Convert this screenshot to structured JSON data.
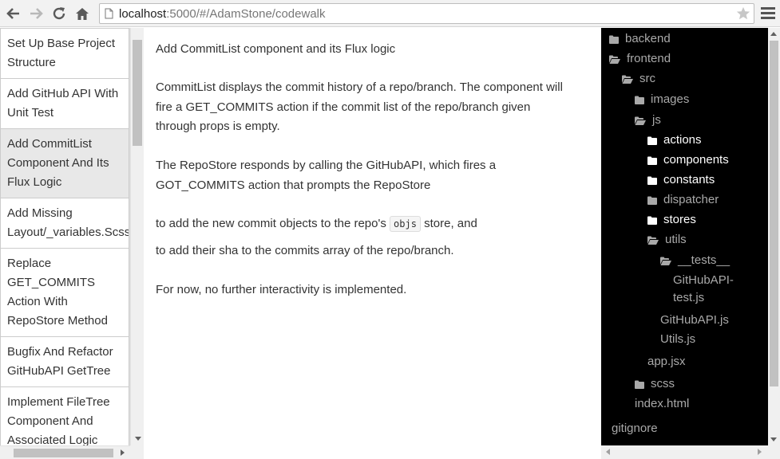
{
  "browser": {
    "url_host": "localhost",
    "url_path": ":5000/#/AdamStone/codewalk"
  },
  "sidebar": {
    "steps": [
      {
        "lines": [
          "Set Up Base Project",
          "Structure"
        ]
      },
      {
        "lines": [
          "Add GitHub API With",
          "Unit Test"
        ]
      },
      {
        "lines": [
          "Add CommitList",
          "Component And Its",
          "Flux Logic"
        ],
        "active": true
      },
      {
        "lines": [
          "Add Missing",
          "Layout/_variables.Scss"
        ]
      },
      {
        "lines": [
          "Replace",
          "GET_COMMITS",
          "Action With",
          "RepoStore Method"
        ]
      },
      {
        "lines": [
          "Bugfix And Refactor",
          "GitHubAPI GetTree"
        ]
      },
      {
        "lines": [
          "Implement FileTree",
          "Component And",
          "Associated Logic"
        ]
      }
    ]
  },
  "main": {
    "title": "Add CommitList component and its Flux logic",
    "para1": [
      "CommitList displays the commit history of a repo/branch. The component will",
      "fire a GET_COMMITS action if the commit list of the repo/branch given",
      "through props is empty."
    ],
    "para2": [
      "The RepoStore responds by calling the GitHubAPI, which fires a",
      "GOT_COMMITS action that prompts the RepoStore"
    ],
    "bullet1_pre": "to add the new commit objects to the repo's",
    "bullet1_code": "objs",
    "bullet1_post": "store, and",
    "bullet2": "to add their sha to the commits array of the repo/branch.",
    "para3": "For now, no further interactivity is implemented."
  },
  "tree": {
    "nodes": [
      {
        "label": "backend",
        "icon": "folder-closed"
      },
      {
        "label": "frontend",
        "icon": "folder-open"
      },
      {
        "label": "src",
        "icon": "folder-open"
      },
      {
        "label": "images",
        "icon": "folder-closed"
      },
      {
        "label": "js",
        "icon": "folder-open"
      },
      {
        "label": "actions",
        "icon": "folder-closed",
        "bright": true
      },
      {
        "label": "components",
        "icon": "folder-closed",
        "bright": true
      },
      {
        "label": "constants",
        "icon": "folder-closed",
        "bright": true
      },
      {
        "label": "dispatcher",
        "icon": "folder-closed"
      },
      {
        "label": "stores",
        "icon": "folder-closed",
        "bright": true
      },
      {
        "label": "utils",
        "icon": "folder-open"
      },
      {
        "label": "__tests__",
        "icon": "folder-open"
      },
      {
        "label": "GitHubAPI-",
        "icon": "none"
      },
      {
        "label": "test.js",
        "icon": "none"
      },
      {
        "label": "GitHubAPI.js",
        "icon": "none"
      },
      {
        "label": "Utils.js",
        "icon": "none"
      },
      {
        "label": "app.jsx",
        "icon": "none"
      },
      {
        "label": "scss",
        "icon": "folder-closed"
      },
      {
        "label": "index.html",
        "icon": "none"
      },
      {
        "label": "gitignore",
        "icon": "none"
      }
    ]
  }
}
